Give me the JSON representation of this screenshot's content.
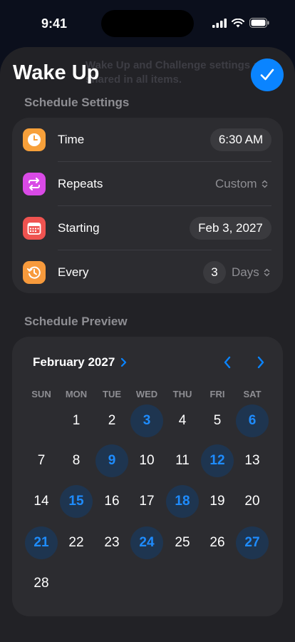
{
  "status": {
    "time": "9:41"
  },
  "background_hint": "Wake Up and Challenge settings are shared in all items.",
  "header": {
    "title": "Wake Up",
    "done_icon": "checkmark-icon"
  },
  "schedule_settings": {
    "section_label": "Schedule Settings",
    "time": {
      "label": "Time",
      "value": "6:30 AM"
    },
    "repeats": {
      "label": "Repeats",
      "value": "Custom"
    },
    "starting": {
      "label": "Starting",
      "value": "Feb 3, 2027"
    },
    "every": {
      "label": "Every",
      "count": "3",
      "unit": "Days"
    }
  },
  "schedule_preview": {
    "section_label": "Schedule Preview",
    "month_label": "February 2027",
    "weekdays": [
      "SUN",
      "MON",
      "TUE",
      "WED",
      "THU",
      "FRI",
      "SAT"
    ],
    "days": [
      "1",
      "2",
      "3",
      "4",
      "5",
      "6",
      "7",
      "8",
      "9",
      "10",
      "11",
      "12",
      "13",
      "14",
      "15",
      "16",
      "17",
      "18",
      "19",
      "20",
      "21",
      "22",
      "23",
      "24",
      "25",
      "26",
      "27",
      "28"
    ],
    "first_weekday_index": 1,
    "selected_days": [
      3,
      6,
      9,
      12,
      15,
      18,
      21,
      24,
      27
    ]
  },
  "colors": {
    "accent": "#0a84ff",
    "selected_day_bg": "#1e3550",
    "selected_day_text": "#1e8cff",
    "time_icon_bg": "#f7a03a",
    "repeats_icon_bg": "#d94ae6",
    "starting_icon_bg": "#ef5350",
    "every_icon_bg": "#f79a3c"
  }
}
